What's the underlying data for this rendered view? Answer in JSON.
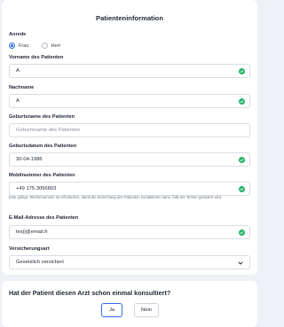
{
  "form": {
    "title": "Patienteninformation",
    "salutation": {
      "label": "Anrede",
      "options": [
        "Frau",
        "Herr"
      ],
      "selected": "Frau"
    },
    "first_name": {
      "label": "Vorname des Patienten",
      "value": "A"
    },
    "last_name": {
      "label": "Nachname",
      "value": "A"
    },
    "birth_name": {
      "label": "Geburtsname des Patienten",
      "placeholder": "Geburtsname des Patienten"
    },
    "birth_date": {
      "label": "Geburtsdatum des Patienten",
      "value": "30-04-1986"
    },
    "mobile": {
      "label": "Mobilnummer des Patienten",
      "value": "+49 175 3056803",
      "hint": "Eine gültige Telefonnummer ist erforderlich, damit die Einrichtung den Patienten kontaktieren kann, falls der Termin geändert wird."
    },
    "email": {
      "label": "E-Mail-Adresse des Patienten",
      "value": "tes||@email.fr"
    },
    "insurance": {
      "label": "Versicherungsart",
      "value": "Gesetzlich versichert"
    }
  },
  "consult": {
    "question": "Hat der Patient diesen Arzt schon einmal konsultiert?",
    "yes_label": "Ja",
    "no_label": "Nein"
  },
  "colors": {
    "accent": "#2f6fe0",
    "valid": "#22b26b",
    "background": "#eef1f5"
  },
  "icons": {
    "valid": "check-circle-icon",
    "select": "chevron-down-icon"
  }
}
